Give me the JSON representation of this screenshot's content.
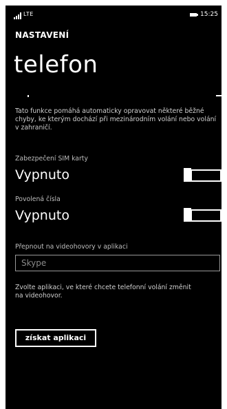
{
  "status_bar": {
    "network": "LTE",
    "time": "15:25"
  },
  "header": {
    "app_title": "NASTAVENÍ",
    "page_title": "telefon"
  },
  "description": "Tato funkce pomáhá automaticky opravovat některé běžné chyby, ke kterým dochází při mezinárodním volání nebo volání v zahraničí.",
  "settings": {
    "sim_security": {
      "label": "Zabezpečení SIM karty",
      "value": "Vypnuto",
      "toggle_on": false
    },
    "fixed_numbers": {
      "label": "Povolená čísla",
      "value": "Vypnuto",
      "toggle_on": false
    }
  },
  "video_calls": {
    "label": "Přepnout na videohovory v aplikaci",
    "input_value": "Skype",
    "hint": "Zvolte aplikaci, ve které chcete telefonní volání změnit na videohovor."
  },
  "actions": {
    "get_apps": "získat aplikaci"
  },
  "colors": {
    "background": "#000000",
    "text": "#ffffff",
    "secondary_text": "#bdbdbd"
  }
}
